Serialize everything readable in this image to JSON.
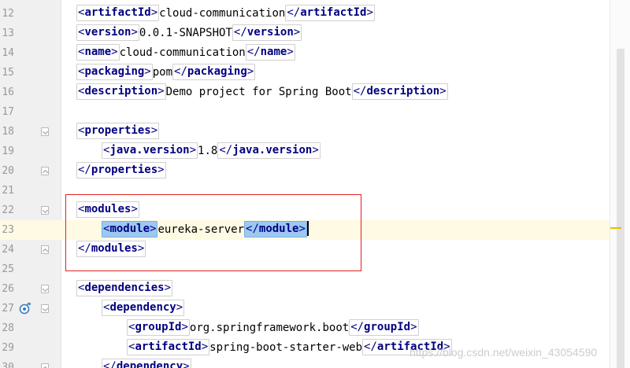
{
  "lines": [
    {
      "num": "12",
      "indent": 1,
      "tokens": [
        {
          "t": "tag",
          "v": "artifactId"
        },
        {
          "t": "text",
          "v": "cloud-communication"
        },
        {
          "t": "ctag",
          "v": "artifactId"
        }
      ]
    },
    {
      "num": "13",
      "indent": 1,
      "tokens": [
        {
          "t": "tag",
          "v": "version"
        },
        {
          "t": "text",
          "v": "0.0.1-SNAPSHOT"
        },
        {
          "t": "ctag",
          "v": "version"
        }
      ]
    },
    {
      "num": "14",
      "indent": 1,
      "tokens": [
        {
          "t": "tag",
          "v": "name"
        },
        {
          "t": "text",
          "v": "cloud-communication"
        },
        {
          "t": "ctag",
          "v": "name"
        }
      ]
    },
    {
      "num": "15",
      "indent": 1,
      "tokens": [
        {
          "t": "tag",
          "v": "packaging"
        },
        {
          "t": "text",
          "v": "pom"
        },
        {
          "t": "ctag",
          "v": "packaging"
        }
      ]
    },
    {
      "num": "16",
      "indent": 1,
      "tokens": [
        {
          "t": "tag",
          "v": "description"
        },
        {
          "t": "text",
          "v": "Demo project for Spring Boot"
        },
        {
          "t": "ctag",
          "v": "description"
        }
      ]
    },
    {
      "num": "17",
      "indent": 1,
      "tokens": []
    },
    {
      "num": "18",
      "indent": 1,
      "fold": "open",
      "tokens": [
        {
          "t": "tag",
          "v": "properties"
        }
      ]
    },
    {
      "num": "19",
      "indent": 2,
      "tokens": [
        {
          "t": "tag",
          "v": "java.version"
        },
        {
          "t": "text",
          "v": "1.8"
        },
        {
          "t": "ctag",
          "v": "java.version"
        }
      ]
    },
    {
      "num": "20",
      "indent": 1,
      "fold": "close",
      "tokens": [
        {
          "t": "ctag",
          "v": "properties"
        }
      ]
    },
    {
      "num": "21",
      "indent": 1,
      "tokens": []
    },
    {
      "num": "22",
      "indent": 1,
      "fold": "open",
      "tokens": [
        {
          "t": "tag",
          "v": "modules"
        }
      ]
    },
    {
      "num": "23",
      "indent": 2,
      "current": true,
      "tokens": [
        {
          "t": "tag",
          "v": "module",
          "hl": true
        },
        {
          "t": "text",
          "v": "eureka-server"
        },
        {
          "t": "ctag",
          "v": "module",
          "hl": true
        },
        {
          "t": "caret"
        }
      ]
    },
    {
      "num": "24",
      "indent": 1,
      "fold": "close",
      "tokens": [
        {
          "t": "ctag",
          "v": "modules"
        }
      ]
    },
    {
      "num": "25",
      "indent": 1,
      "tokens": []
    },
    {
      "num": "26",
      "indent": 1,
      "fold": "open",
      "tokens": [
        {
          "t": "tag",
          "v": "dependencies"
        }
      ]
    },
    {
      "num": "27",
      "indent": 2,
      "fold": "open",
      "icon": "spring-bean-icon",
      "tokens": [
        {
          "t": "tag",
          "v": "dependency"
        }
      ]
    },
    {
      "num": "28",
      "indent": 3,
      "tokens": [
        {
          "t": "tag",
          "v": "groupId"
        },
        {
          "t": "text",
          "v": "org.springframework.boot"
        },
        {
          "t": "ctag",
          "v": "groupId"
        }
      ]
    },
    {
      "num": "29",
      "indent": 3,
      "tokens": [
        {
          "t": "tag",
          "v": "artifactId"
        },
        {
          "t": "text",
          "v": "spring-boot-starter-web"
        },
        {
          "t": "ctag",
          "v": "artifactId"
        }
      ]
    },
    {
      "num": "30",
      "indent": 2,
      "fold": "close",
      "tokens": [
        {
          "t": "ctag",
          "v": "dependency"
        }
      ]
    }
  ],
  "watermark": "https://blog.csdn.net/weixin_43054590",
  "colors": {
    "tag": "#000080",
    "highlight": "#9cc8f2",
    "current_line": "#fffae3",
    "annotation_box": "#e02020"
  }
}
